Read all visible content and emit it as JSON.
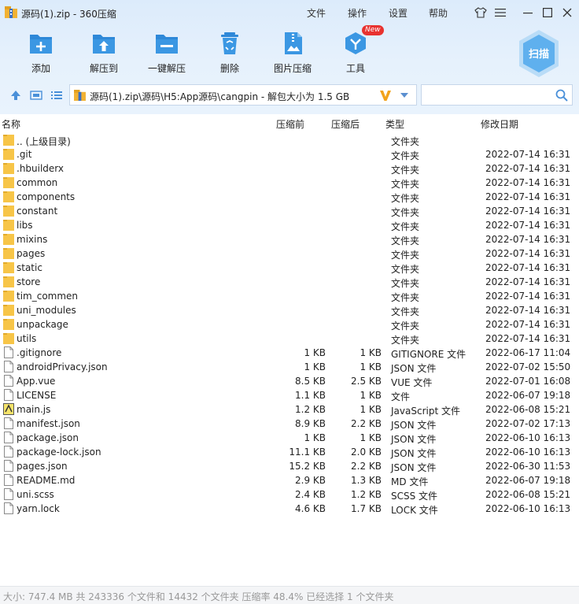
{
  "window": {
    "title": "源码(1).zip - 360压缩",
    "menus": [
      "文件",
      "操作",
      "设置",
      "帮助"
    ]
  },
  "toolbar": {
    "buttons": [
      {
        "label": "添加",
        "icon": "add-icon"
      },
      {
        "label": "解压到",
        "icon": "extract-to-icon"
      },
      {
        "label": "一键解压",
        "icon": "one-click-extract-icon"
      },
      {
        "label": "删除",
        "icon": "delete-icon"
      },
      {
        "label": "图片压缩",
        "icon": "image-compress-icon"
      },
      {
        "label": "工具",
        "icon": "tools-icon"
      }
    ],
    "new_badge": "New",
    "scan_label": "扫描"
  },
  "addressbar": {
    "path": "源码(1).zip\\源码\\H5:App源码\\cangpin - 解包大小为 1.5 GB",
    "search_placeholder": ""
  },
  "columns": {
    "name": "名称",
    "size": "压缩前",
    "packed": "压缩后",
    "type": "类型",
    "date": "修改日期"
  },
  "files": [
    {
      "name": ".. (上级目录)",
      "size": "",
      "packed": "",
      "type": "文件夹",
      "date": "",
      "kind": "folder"
    },
    {
      "name": ".git",
      "size": "",
      "packed": "",
      "type": "文件夹",
      "date": "2022-07-14 16:31",
      "kind": "folder"
    },
    {
      "name": ".hbuilderx",
      "size": "",
      "packed": "",
      "type": "文件夹",
      "date": "2022-07-14 16:31",
      "kind": "folder"
    },
    {
      "name": "common",
      "size": "",
      "packed": "",
      "type": "文件夹",
      "date": "2022-07-14 16:31",
      "kind": "folder"
    },
    {
      "name": "components",
      "size": "",
      "packed": "",
      "type": "文件夹",
      "date": "2022-07-14 16:31",
      "kind": "folder"
    },
    {
      "name": "constant",
      "size": "",
      "packed": "",
      "type": "文件夹",
      "date": "2022-07-14 16:31",
      "kind": "folder"
    },
    {
      "name": "libs",
      "size": "",
      "packed": "",
      "type": "文件夹",
      "date": "2022-07-14 16:31",
      "kind": "folder"
    },
    {
      "name": "mixins",
      "size": "",
      "packed": "",
      "type": "文件夹",
      "date": "2022-07-14 16:31",
      "kind": "folder"
    },
    {
      "name": "pages",
      "size": "",
      "packed": "",
      "type": "文件夹",
      "date": "2022-07-14 16:31",
      "kind": "folder"
    },
    {
      "name": "static",
      "size": "",
      "packed": "",
      "type": "文件夹",
      "date": "2022-07-14 16:31",
      "kind": "folder"
    },
    {
      "name": "store",
      "size": "",
      "packed": "",
      "type": "文件夹",
      "date": "2022-07-14 16:31",
      "kind": "folder"
    },
    {
      "name": "tim_commen",
      "size": "",
      "packed": "",
      "type": "文件夹",
      "date": "2022-07-14 16:31",
      "kind": "folder"
    },
    {
      "name": "uni_modules",
      "size": "",
      "packed": "",
      "type": "文件夹",
      "date": "2022-07-14 16:31",
      "kind": "folder"
    },
    {
      "name": "unpackage",
      "size": "",
      "packed": "",
      "type": "文件夹",
      "date": "2022-07-14 16:31",
      "kind": "folder"
    },
    {
      "name": "utils",
      "size": "",
      "packed": "",
      "type": "文件夹",
      "date": "2022-07-14 16:31",
      "kind": "folder"
    },
    {
      "name": ".gitignore",
      "size": "1 KB",
      "packed": "1 KB",
      "type": "GITIGNORE 文件",
      "date": "2022-06-17 11:04",
      "kind": "file"
    },
    {
      "name": "androidPrivacy.json",
      "size": "1 KB",
      "packed": "1 KB",
      "type": "JSON 文件",
      "date": "2022-07-02 15:50",
      "kind": "file"
    },
    {
      "name": "App.vue",
      "size": "8.5 KB",
      "packed": "2.5 KB",
      "type": "VUE 文件",
      "date": "2022-07-01 16:08",
      "kind": "file"
    },
    {
      "name": "LICENSE",
      "size": "1.1 KB",
      "packed": "1 KB",
      "type": "文件",
      "date": "2022-06-07 19:18",
      "kind": "file"
    },
    {
      "name": "main.js",
      "size": "1.2 KB",
      "packed": "1 KB",
      "type": "JavaScript 文件",
      "date": "2022-06-08 15:21",
      "kind": "js"
    },
    {
      "name": "manifest.json",
      "size": "8.9 KB",
      "packed": "2.2 KB",
      "type": "JSON 文件",
      "date": "2022-07-02 17:13",
      "kind": "file"
    },
    {
      "name": "package.json",
      "size": "1 KB",
      "packed": "1 KB",
      "type": "JSON 文件",
      "date": "2022-06-10 16:13",
      "kind": "file"
    },
    {
      "name": "package-lock.json",
      "size": "11.1 KB",
      "packed": "2.0 KB",
      "type": "JSON 文件",
      "date": "2022-06-10 16:13",
      "kind": "file"
    },
    {
      "name": "pages.json",
      "size": "15.2 KB",
      "packed": "2.2 KB",
      "type": "JSON 文件",
      "date": "2022-06-30 11:53",
      "kind": "file"
    },
    {
      "name": "README.md",
      "size": "2.9 KB",
      "packed": "1.3 KB",
      "type": "MD 文件",
      "date": "2022-06-07 19:18",
      "kind": "file"
    },
    {
      "name": "uni.scss",
      "size": "2.4 KB",
      "packed": "1.2 KB",
      "type": "SCSS 文件",
      "date": "2022-06-08 15:21",
      "kind": "file"
    },
    {
      "name": "yarn.lock",
      "size": "4.6 KB",
      "packed": "1.7 KB",
      "type": "LOCK 文件",
      "date": "2022-06-10 16:13",
      "kind": "file"
    }
  ],
  "status": "大小: 747.4 MB 共 243336 个文件和 14432 个文件夹 压缩率 48.4% 已经选择 1 个文件夹",
  "colors": {
    "accent": "#2e88d8",
    "folder": "#f7c548",
    "header_bg": "#e3effb"
  }
}
